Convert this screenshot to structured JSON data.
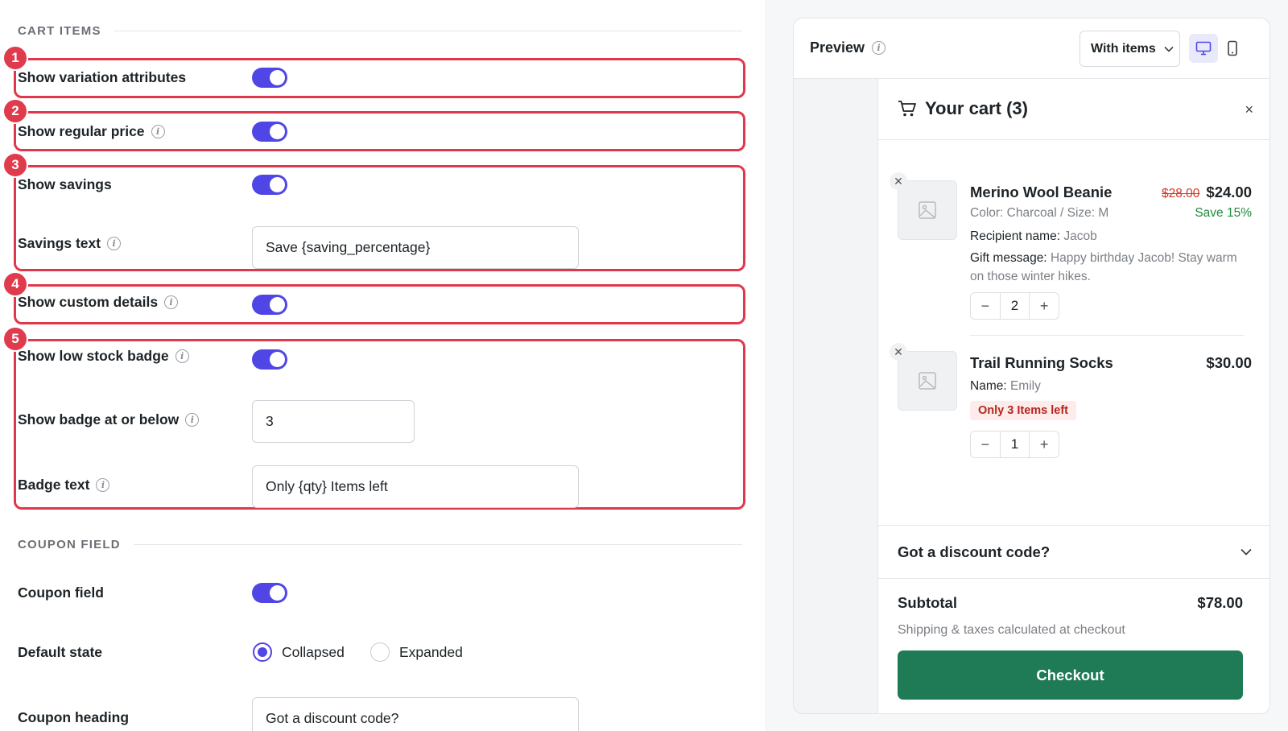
{
  "settings": {
    "cart_items_heading": "CART ITEMS",
    "coupon_heading_section": "COUPON FIELD",
    "rows": {
      "variation": "Show variation attributes",
      "regular_price": "Show regular price",
      "savings": "Show savings",
      "savings_text": "Savings text",
      "custom_details": "Show custom details",
      "low_stock": "Show low stock badge",
      "badge_at": "Show badge at or below",
      "badge_text": "Badge text",
      "coupon_field": "Coupon field",
      "default_state": "Default state",
      "coupon_heading": "Coupon heading"
    },
    "values": {
      "savings_text": "Save {saving_percentage}",
      "badge_threshold": "3",
      "badge_text": "Only {qty} Items left",
      "coupon_heading": "Got a discount code?"
    },
    "toggles": {
      "variation": true,
      "regular_price": true,
      "savings": true,
      "custom_details": true,
      "low_stock": true,
      "coupon_field": true
    },
    "default_state_options": [
      "Collapsed",
      "Expanded"
    ],
    "default_state_selected": "Collapsed",
    "callouts": [
      "1",
      "2",
      "3",
      "4",
      "5"
    ],
    "info_glyph": "i"
  },
  "preview": {
    "title": "Preview",
    "mode_select": "With items",
    "cart_title": "Your cart (3)",
    "close": "×",
    "items": [
      {
        "name": "Merino Wool Beanie",
        "old_price": "$28.00",
        "price": "$24.00",
        "save": "Save 15%",
        "variation": "Color: Charcoal / Size: M",
        "recipient_label": "Recipient name:",
        "recipient_value": "Jacob",
        "gift_label": "Gift message:",
        "gift_value": "Happy birthday Jacob! Stay warm on those winter hikes.",
        "qty": "2"
      },
      {
        "name": "Trail Running Socks",
        "price": "$30.00",
        "name_label": "Name:",
        "name_value": "Emily",
        "stock_badge": "Only 3 Items left",
        "qty": "1"
      }
    ],
    "discount_label": "Got a discount code?",
    "subtotal_label": "Subtotal",
    "subtotal_value": "$78.00",
    "shipping_note": "Shipping & taxes calculated at checkout",
    "checkout_label": "Checkout",
    "stepper_minus": "−",
    "stepper_plus": "+",
    "remove_glyph": "✕"
  },
  "colors": {
    "accent": "#4f46e5",
    "highlight": "#e0384b",
    "checkout": "#1f7a56",
    "save": "#1e8a3e",
    "old_price": "#d03a2b"
  }
}
